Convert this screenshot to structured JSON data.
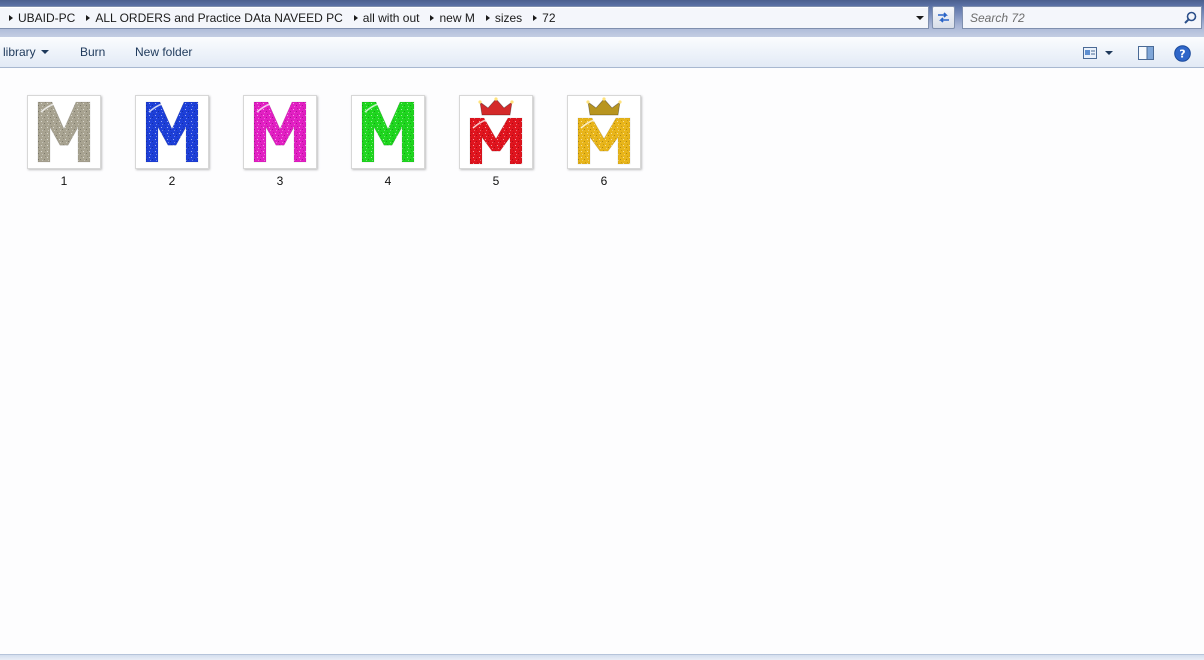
{
  "address_bar": {
    "crumbs": [
      "UBAID-PC",
      "ALL ORDERS and Practice DAta NAVEED PC",
      "all with out",
      "new M",
      "sizes",
      "72"
    ]
  },
  "search": {
    "placeholder": "Search 72"
  },
  "toolbar": {
    "library_label": "library",
    "burn_label": "Burn",
    "new_folder_label": "New folder"
  },
  "files": [
    {
      "name": "1",
      "letter": "M",
      "color": "#a8a391",
      "crown": false
    },
    {
      "name": "2",
      "letter": "M",
      "color": "#1d3fd8",
      "crown": false
    },
    {
      "name": "3",
      "letter": "M",
      "color": "#e21fc3",
      "crown": false
    },
    {
      "name": "4",
      "letter": "M",
      "color": "#1fd61f",
      "crown": false
    },
    {
      "name": "5",
      "letter": "M",
      "color": "#e0141e",
      "crown": true,
      "crown_color": "#d42a2a"
    },
    {
      "name": "6",
      "letter": "M",
      "color": "#e8b51a",
      "crown": true,
      "crown_color": "#b89520"
    }
  ],
  "icons": {
    "address_dropdown": "chevron-down-icon",
    "refresh": "refresh-icon",
    "search": "search-icon",
    "change_view": "view-icon",
    "preview_pane": "preview-pane-icon",
    "help": "help-icon"
  }
}
